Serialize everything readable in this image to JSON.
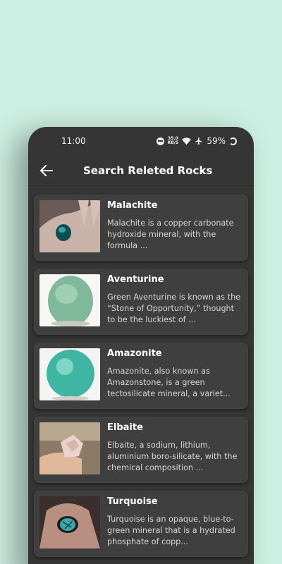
{
  "status_bar": {
    "time": "11:00",
    "battery": "59%",
    "speed_top": "35.0",
    "speed_bottom": "KB/S",
    "icons": [
      "do-not-disturb-icon",
      "data-speed-icon",
      "wifi-icon",
      "airplane-icon",
      "battery-icon"
    ]
  },
  "app_bar": {
    "title": "Search Releted Rocks",
    "back_icon": "arrow-left-icon"
  },
  "colors": {
    "background": "#cdeee2",
    "surface": "#353535",
    "card": "#3f3f3f",
    "text_primary": "#ffffff",
    "text_secondary": "#d6d6d6"
  },
  "rocks": [
    {
      "name": "Malachite",
      "description": "Malachite is a copper carbonate hydroxide mineral, with the formula ..."
    },
    {
      "name": "Aventurine",
      "description": "Green Aventurine is known as the “Stone of Opportunity,” thought to be the luckiest of ..."
    },
    {
      "name": "Amazonite",
      "description": "Amazonite, also known as Amazonstone, is a green tectosilicate mineral, a variet..."
    },
    {
      "name": "Elbaite",
      "description": "Elbaite, a sodium, lithium, aluminium boro-silicate, with the chemical composition ..."
    },
    {
      "name": "Turquoise",
      "description": "Turquoise is an opaque, blue-to-green mineral that is a hydrated phosphate of copp..."
    }
  ]
}
